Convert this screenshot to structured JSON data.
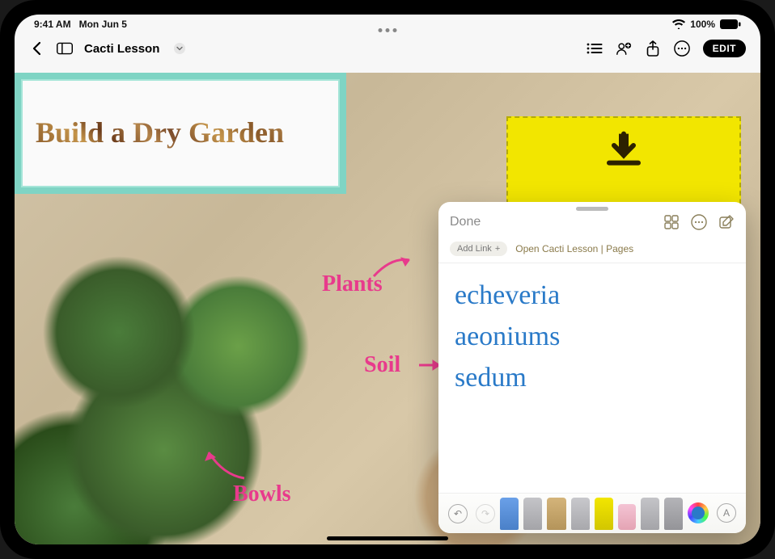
{
  "status": {
    "time": "9:41 AM",
    "date": "Mon Jun 5",
    "battery_pct": "100%"
  },
  "nav": {
    "doc_title": "Cacti Lesson",
    "edit_label": "EDIT"
  },
  "canvas": {
    "title": "Build a Dry Garden",
    "annot_plants": "Plants",
    "annot_soil": "Soil",
    "annot_bowls": "Bowls"
  },
  "quicknote": {
    "done_label": "Done",
    "addlink_label": "Add Link",
    "open_label": "Open Cacti Lesson | Pages",
    "lines": [
      "echeveria",
      "aeoniums",
      "sedum"
    ]
  }
}
